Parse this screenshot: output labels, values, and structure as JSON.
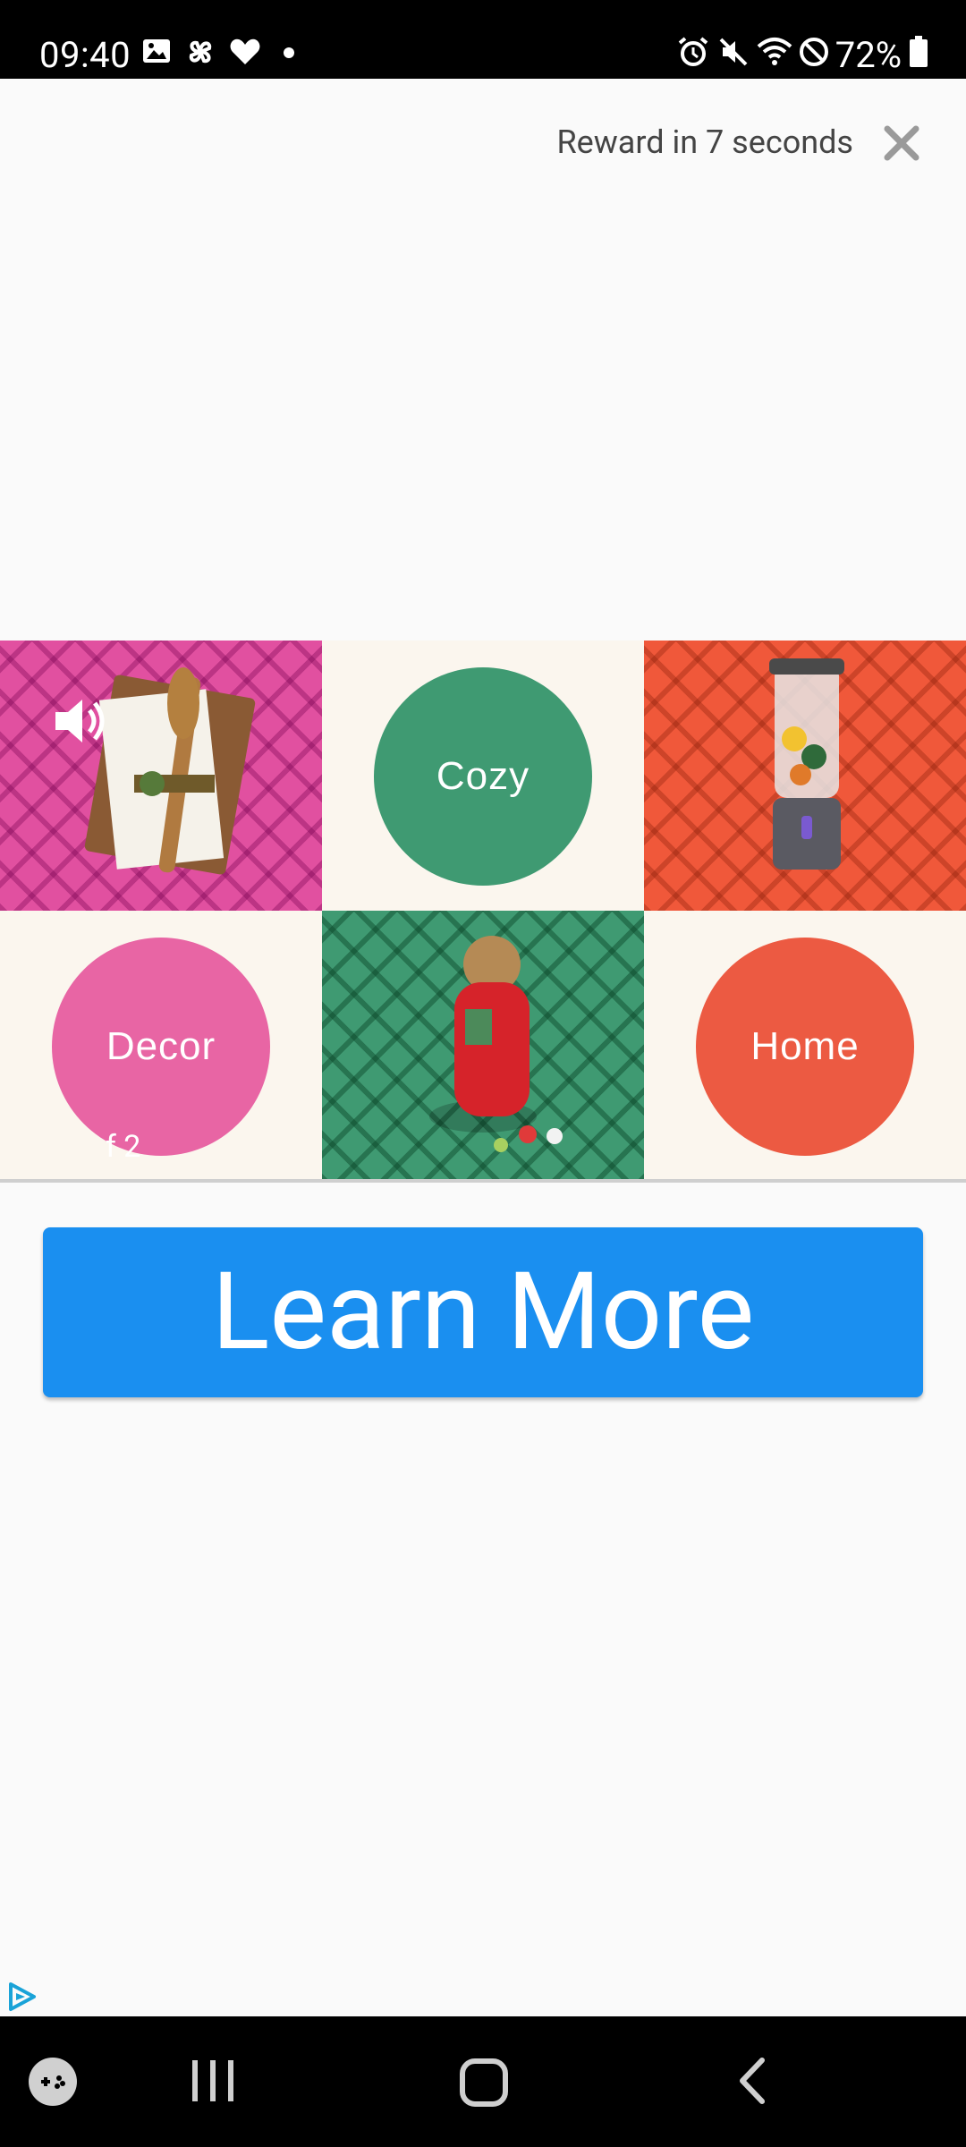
{
  "status_bar": {
    "time": "09:40",
    "battery": "72%",
    "left_icons": [
      "gallery-icon",
      "pinwheel-icon",
      "heart-icon",
      "dot-icon"
    ],
    "right_icons": [
      "alarm-icon",
      "mute-icon",
      "wifi-icon",
      "dnd-icon",
      "battery-icon"
    ]
  },
  "ad": {
    "reward_text": "Reward in 7 seconds",
    "close_icon": "close-icon",
    "sound_icon": "speaker-icon",
    "tiles": {
      "cozy": "Cozy",
      "decor": "Decor",
      "home": "Home"
    },
    "pager_text": "f 2",
    "cta_label": "Learn More",
    "adchoices_icon": "adchoices-icon",
    "colors": {
      "cta": "#1a8ff0",
      "pink": "#e150a0",
      "green": "#3f9a72",
      "red": "#f0583a",
      "cream": "#fbf6ee"
    }
  },
  "nav_bar": {
    "icons": [
      "game-launcher-icon",
      "recents-icon",
      "home-icon",
      "back-icon"
    ]
  }
}
